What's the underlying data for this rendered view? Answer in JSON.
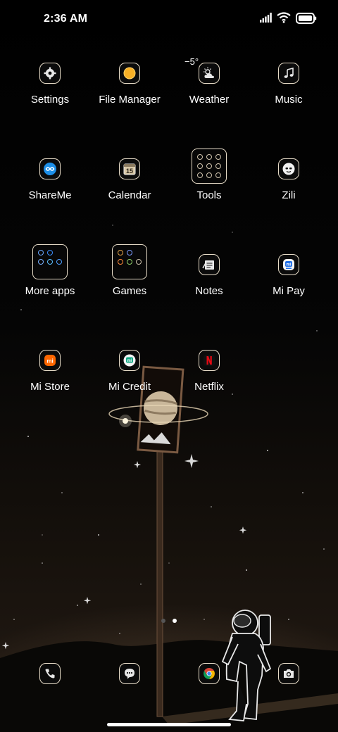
{
  "status_bar": {
    "time": "2:36 AM",
    "icons": [
      "signal-icon",
      "wifi-icon",
      "battery-icon"
    ]
  },
  "weather_widget": {
    "temperature": "−5°"
  },
  "apps": [
    {
      "label": "Settings",
      "icon": "gear-icon"
    },
    {
      "label": "File Manager",
      "icon": "folder-icon"
    },
    {
      "label": "Weather",
      "icon": "weather-icon"
    },
    {
      "label": "Music",
      "icon": "music-note-icon"
    },
    {
      "label": "ShareMe",
      "icon": "shareme-icon"
    },
    {
      "label": "Calendar",
      "icon": "calendar-icon"
    },
    {
      "label": "Tools",
      "icon": "folder-icon"
    },
    {
      "label": "Zili",
      "icon": "zili-icon"
    },
    {
      "label": "More apps",
      "icon": "folder-icon"
    },
    {
      "label": "Games",
      "icon": "folder-icon"
    },
    {
      "label": "Notes",
      "icon": "notes-icon"
    },
    {
      "label": "Mi Pay",
      "icon": "mi-pay-icon"
    },
    {
      "label": "Mi Store",
      "icon": "mi-store-icon"
    },
    {
      "label": "Mi Credit",
      "icon": "mi-credit-icon"
    },
    {
      "label": "Netflix",
      "icon": "netflix-icon"
    }
  ],
  "calendar_day": "15",
  "page_indicator": {
    "pages": 2,
    "current": 2
  },
  "dock": [
    {
      "icon": "phone-icon"
    },
    {
      "icon": "messages-icon"
    },
    {
      "icon": "chrome-icon"
    },
    {
      "icon": "camera-icon"
    }
  ],
  "colors": {
    "icon_border": "#e7dcc8",
    "netflix_red": "#e50914",
    "mi_orange": "#ff6700"
  }
}
